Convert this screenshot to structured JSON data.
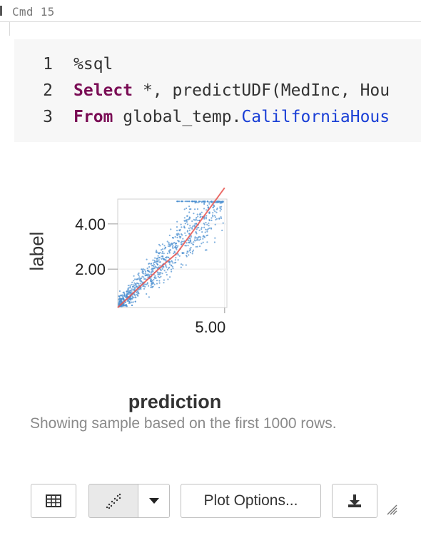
{
  "cell": {
    "title": "Cmd 15"
  },
  "code": {
    "lines": [
      {
        "num": "1",
        "text": "%sql"
      },
      {
        "num": "2",
        "keyword": "Select",
        "rest": " *, predictUDF(MedInc, Hou"
      },
      {
        "num": "3",
        "keyword": "From",
        "rest": " global_temp.",
        "object": "CalilforniaHous"
      }
    ]
  },
  "chart_data": {
    "type": "scatter",
    "xlabel": "prediction",
    "ylabel": "label",
    "x_ticks": [
      "5.00"
    ],
    "y_ticks": [
      "2.00",
      "4.00"
    ],
    "xlim": [
      0.3,
      5.1
    ],
    "ylim": [
      0.3,
      5.1
    ],
    "fit_line": {
      "x": [
        0.3,
        5.0
      ],
      "y": [
        0.3,
        5.6
      ],
      "color": "#e8534f"
    },
    "point_color": "#4a8fd0",
    "note": "Showing sample based on the first 1000 rows."
  },
  "toolbar": {
    "table_icon": "table-icon",
    "plot_icon": "scatter-plot-icon",
    "dropdown_icon": "caret-down-icon",
    "plot_options_label": "Plot Options...",
    "download_icon": "download-icon"
  }
}
